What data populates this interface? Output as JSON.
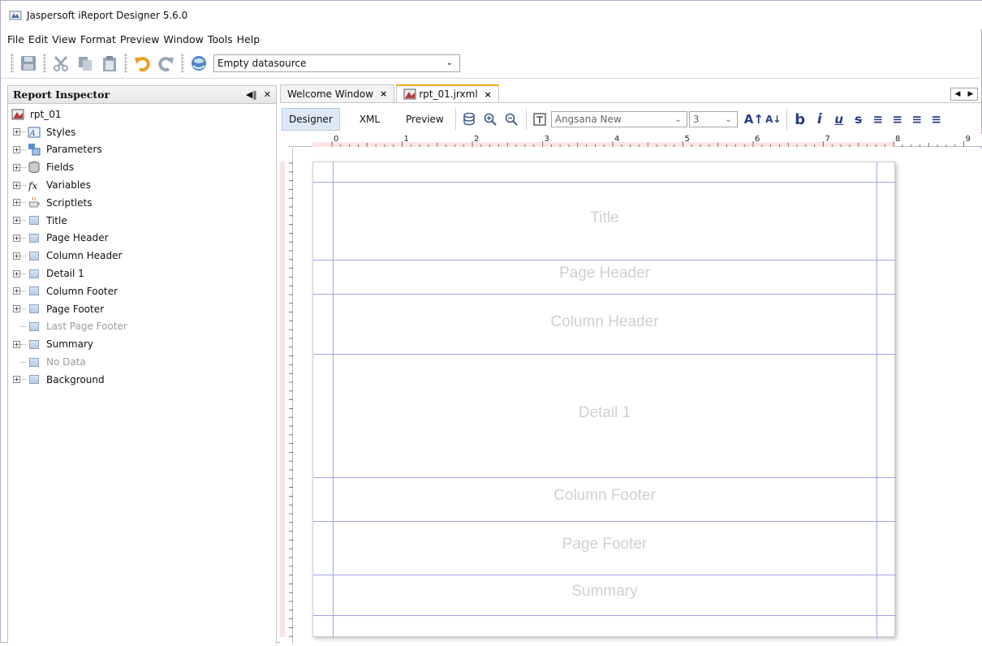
{
  "window": {
    "title": "Jaspersoft iReport Designer 5.6.0"
  },
  "menu": [
    "File",
    "Edit",
    "View",
    "Format",
    "Preview",
    "Window",
    "Tools",
    "Help"
  ],
  "toolbar": {
    "datasource": "Empty datasource"
  },
  "inspector": {
    "title": "Report Inspector",
    "root": "rpt_01",
    "items": [
      {
        "label": "Styles",
        "icon": "styles-icon",
        "disabled": false
      },
      {
        "label": "Parameters",
        "icon": "parameters-icon",
        "disabled": false
      },
      {
        "label": "Fields",
        "icon": "fields-icon",
        "disabled": false
      },
      {
        "label": "Variables",
        "icon": "variables-icon",
        "disabled": false
      },
      {
        "label": "Scriptlets",
        "icon": "scriptlets-icon",
        "disabled": false
      },
      {
        "label": "Title",
        "icon": "band-icon",
        "disabled": false
      },
      {
        "label": "Page Header",
        "icon": "band-icon",
        "disabled": false
      },
      {
        "label": "Column Header",
        "icon": "band-icon",
        "disabled": false
      },
      {
        "label": "Detail 1",
        "icon": "band-icon",
        "disabled": false
      },
      {
        "label": "Column Footer",
        "icon": "band-icon",
        "disabled": false
      },
      {
        "label": "Page Footer",
        "icon": "band-icon",
        "disabled": false
      },
      {
        "label": "Last Page Footer",
        "icon": "band-icon",
        "disabled": true
      },
      {
        "label": "Summary",
        "icon": "band-icon",
        "disabled": false
      },
      {
        "label": "No Data",
        "icon": "band-icon",
        "disabled": true
      },
      {
        "label": "Background",
        "icon": "band-icon",
        "disabled": false
      }
    ]
  },
  "tabs": [
    {
      "label": "Welcome Window",
      "active": false
    },
    {
      "label": "rpt_01.jrxml",
      "active": true
    }
  ],
  "editor": {
    "modes": [
      "Designer",
      "XML",
      "Preview"
    ],
    "font": "Angsana New",
    "font_size": "3",
    "ruler_labels": [
      "0",
      "1",
      "2",
      "3",
      "4",
      "5",
      "6",
      "7",
      "8",
      "9"
    ],
    "bands": [
      "Title",
      "Page Header",
      "Column Header",
      "Detail 1",
      "Column Footer",
      "Page Footer",
      "Summary"
    ]
  }
}
